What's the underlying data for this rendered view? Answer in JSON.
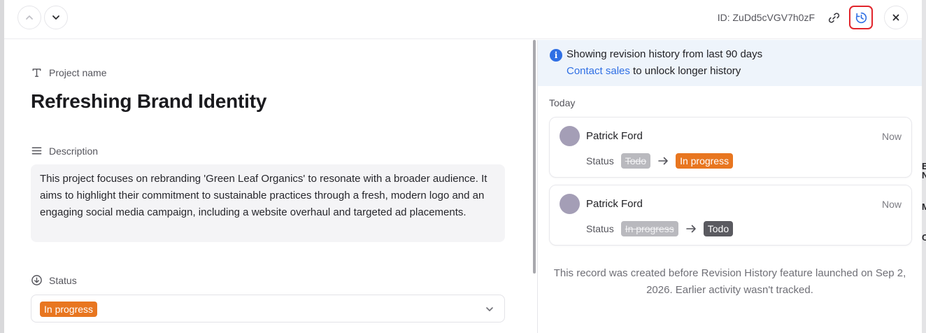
{
  "topbar": {
    "record_id": "ID: ZuDd5cVGV7h0zF"
  },
  "fields": {
    "name_label": "Project name",
    "name_value": "Refreshing Brand Identity",
    "description_label": "Description",
    "description_value": "This project focuses on rebranding 'Green Leaf Organics' to resonate with a broader audience. It aims to highlight their commitment to sustainable practices through a fresh, modern logo and an engaging social media campaign, including a website overhaul and targeted ad placements.",
    "status_label": "Status",
    "status_value": "In progress"
  },
  "history": {
    "banner_title": "Showing revision history from last 90 days",
    "banner_link": "Contact sales",
    "banner_suffix": " to unlock longer history",
    "group_label": "Today",
    "entries": [
      {
        "user": "Patrick Ford",
        "time": "Now",
        "field": "Status",
        "from": "Todo",
        "to": "In progress"
      },
      {
        "user": "Patrick Ford",
        "time": "Now",
        "field": "Status",
        "from": "In progress",
        "to": "Todo"
      }
    ],
    "footer_note": "This record was created before Revision History feature launched on Sep 2, 2026. Earlier activity wasn't tracked."
  },
  "background": {
    "letters": [
      "E",
      "N",
      "M",
      "C"
    ]
  },
  "colors": {
    "in_progress": "#e87620",
    "todo": "#5a5a60",
    "link": "#2f6fe4",
    "highlight": "#e1252c"
  }
}
